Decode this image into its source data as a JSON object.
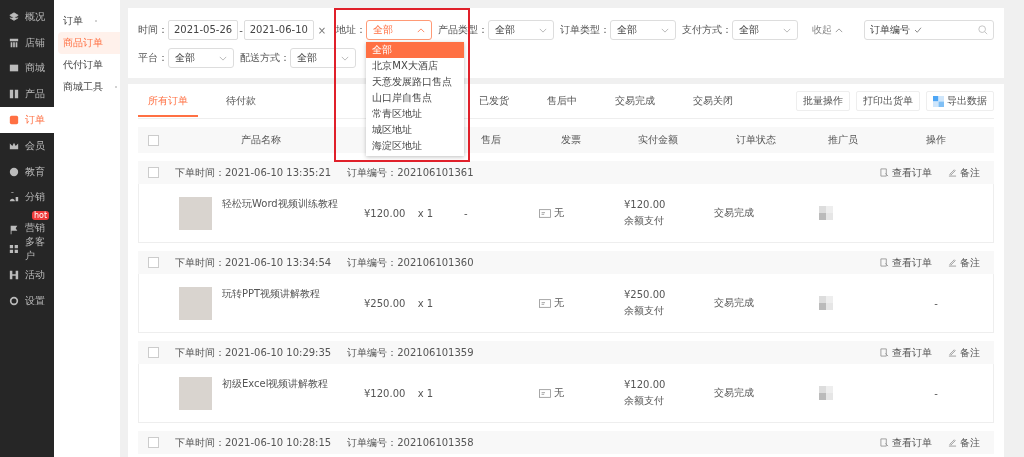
{
  "sidebar": {
    "items": [
      {
        "label": "概况",
        "selected": false
      },
      {
        "label": "店铺",
        "selected": false
      },
      {
        "label": "商城",
        "selected": false
      },
      {
        "label": "产品",
        "selected": false
      },
      {
        "label": "订单",
        "selected": true
      },
      {
        "label": "会员",
        "selected": false
      },
      {
        "label": "教育",
        "selected": false
      },
      {
        "label": "分销",
        "selected": false
      },
      {
        "label": "营销",
        "selected": false,
        "badge": "hot"
      },
      {
        "label": "多客户",
        "selected": false
      },
      {
        "label": "活动",
        "selected": false
      },
      {
        "label": "设置",
        "selected": false
      }
    ]
  },
  "submenu": {
    "items": [
      {
        "label": "订单",
        "kind": "group",
        "selected": false
      },
      {
        "label": "商品订单",
        "kind": "link",
        "selected": true
      },
      {
        "label": "代付订单",
        "kind": "link",
        "selected": false
      },
      {
        "label": "商城工具",
        "kind": "group",
        "selected": false
      }
    ]
  },
  "filters": {
    "time": {
      "label": "时间：",
      "start": "2021-05-26",
      "separator": "-",
      "end": "2021-06-10",
      "clear": "×"
    },
    "selects": [
      {
        "label": "地址：",
        "value": "全部",
        "open": true,
        "highlighted": true,
        "options": [
          {
            "label": "全部",
            "selected": true
          },
          {
            "label": "北京MX大酒店",
            "selected": false
          },
          {
            "label": "天意发展路口售点",
            "selected": false
          },
          {
            "label": "山口岸自售点",
            "selected": false
          },
          {
            "label": "常青区地址",
            "selected": false
          },
          {
            "label": "城区地址",
            "selected": false
          },
          {
            "label": "海淀区地址",
            "selected": false
          }
        ]
      },
      {
        "label": "产品类型：",
        "value": "全部",
        "open": false
      },
      {
        "label": "订单类型：",
        "value": "全部",
        "open": false
      },
      {
        "label": "支付方式：",
        "value": "全部",
        "open": false
      }
    ],
    "collapse": "收起",
    "search": {
      "category": "订单编号"
    },
    "row2": [
      {
        "label": "平台：",
        "value": "全部",
        "open": false
      },
      {
        "label": "配送方式：",
        "value": "全部",
        "open": false
      }
    ]
  },
  "tabs": [
    {
      "label": "所有订单",
      "selected": true
    },
    {
      "label": "待付款",
      "selected": false
    },
    {
      "label": "已发货",
      "selected": false
    },
    {
      "label": "售后中",
      "selected": false
    },
    {
      "label": "交易完成",
      "selected": false
    },
    {
      "label": "交易关闭",
      "selected": false
    }
  ],
  "actions": [
    {
      "label": "批量操作",
      "kind": "plain"
    },
    {
      "label": "打印出货单",
      "kind": "plain"
    },
    {
      "label": "导出数据",
      "kind": "export"
    }
  ],
  "table": {
    "select_all": {
      "checked": false
    },
    "columns": [
      "产品名称",
      "",
      "售后",
      "发票",
      "实付金额",
      "订单状态",
      "推广员",
      "操作"
    ],
    "orders": [
      {
        "checked": false,
        "time_label": "下单时间：",
        "time": "2021-06-10 13:35:21",
        "no_label": "订单编号：",
        "no": "202106101361",
        "product": "轻松玩Word视频训练教程",
        "price": "¥120.00",
        "qty": "x 1",
        "after_sale": "-",
        "invoice": "无",
        "paid": "¥120.00",
        "pay_method": "余额支付",
        "status": "交易完成",
        "view": "查看订单",
        "note": "备注"
      },
      {
        "checked": false,
        "time_label": "下单时间：",
        "time": "2021-06-10 13:34:54",
        "no_label": "订单编号：",
        "no": "202106101360",
        "product": "玩转PPT视频讲解教程",
        "price": "¥250.00",
        "qty": "x 1",
        "invoice": "无",
        "paid": "¥250.00",
        "pay_method": "余额支付",
        "status": "交易完成",
        "op": "-",
        "view": "查看订单",
        "note": "备注"
      },
      {
        "checked": false,
        "time_label": "下单时间：",
        "time": "2021-06-10 10:29:35",
        "no_label": "订单编号：",
        "no": "202106101359",
        "product": "初级Excel视频讲解教程",
        "price": "¥120.00",
        "qty": "x 1",
        "invoice": "无",
        "paid": "¥120.00",
        "pay_method": "余额支付",
        "status": "交易完成",
        "op": "-",
        "view": "查看订单",
        "note": "备注"
      },
      {
        "checked": false,
        "time_label": "下单时间：",
        "time": "2021-06-10 10:28:15",
        "no_label": "订单编号：",
        "no": "202106101358",
        "view": "查看订单",
        "note": "备注"
      }
    ]
  }
}
